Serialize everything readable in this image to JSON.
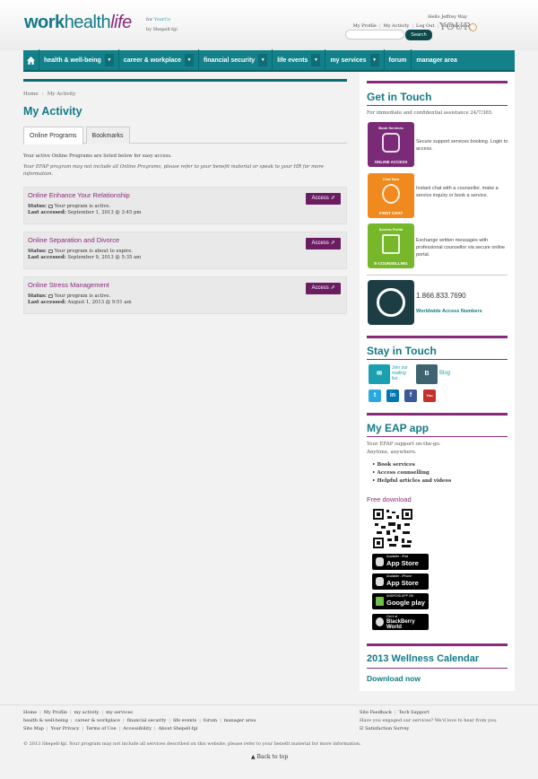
{
  "header": {
    "logo_work": "work",
    "logo_health": "health",
    "logo_life": "life",
    "for_label": "for",
    "company": "YourCo",
    "by_label": "by Shepell·fgi",
    "greeting": "Hello Jeffrey Way",
    "links": [
      "My Profile",
      "My Activity",
      "Log Out",
      "En français"
    ],
    "search_placeholder": "",
    "search_button": "Search",
    "your_logo": "YOUR"
  },
  "nav": {
    "items": [
      {
        "label": "health & well-being",
        "dropdown": true
      },
      {
        "label": "career & workplace",
        "dropdown": true
      },
      {
        "label": "financial security",
        "dropdown": true
      },
      {
        "label": "life events",
        "dropdown": true
      },
      {
        "label": "my services",
        "dropdown": true
      },
      {
        "label": "forum",
        "dropdown": false
      },
      {
        "label": "manager area",
        "dropdown": false
      }
    ]
  },
  "breadcrumb": {
    "home": "Home",
    "current": "My Activity"
  },
  "page_title": "My Activity",
  "tabs": [
    "Online Programs",
    "Bookmarks"
  ],
  "intro": "Your active Online Programs are listed below for easy access.",
  "note": "Your EFAP program may not include all Online Programs, please refer to your benefit material or speak to your HR for more information.",
  "status_label": "Status:",
  "last_accessed_label": "Last accessed:",
  "access_label": "Access",
  "programs": [
    {
      "name": "Online Enhance Your Relationship",
      "status": "Your program is active.",
      "last": "September 1, 2013 @ 3:45 pm"
    },
    {
      "name": "Online Separation and Divorce",
      "status": "Your program is about to expire.",
      "last": "September 9, 2013 @ 5:35 am"
    },
    {
      "name": "Online Stress Management",
      "status": "Your program is active.",
      "last": "August 1, 2013 @ 9:51 am"
    }
  ],
  "sidebar": {
    "get_in_touch": "Get in Touch",
    "git_sub": "For immediate and confidential assistance 24/7/365.",
    "services": [
      {
        "top": "Book Services",
        "label": "ONLINE ACCESS",
        "text": "Secure support services booking. Login to access.",
        "color": "#7b2a78"
      },
      {
        "top": "Chat Now",
        "label": "FIRST CHAT",
        "text": "Instant chat with a counsellor, make a service inquiry or book a service.",
        "color": "#f08a1e"
      },
      {
        "top": "Access Portal",
        "label": "E-COUNSELLING",
        "text": "Exchange written messages with professional counsellor via secure online portal.",
        "color": "#76b82a"
      }
    ],
    "phone": "1.866.833.7690",
    "worldwide": "Worldwide Access Numbers",
    "stay_in_touch": "Stay in Touch",
    "mailing": "Join our mailing list",
    "blog": "Blog",
    "eap_title": "My EAP app",
    "eap_sub1": "Your EFAP support on-the-go.",
    "eap_sub2": "Anytime, anywhere.",
    "eap_bullets": [
      "Book services",
      "Access counselling",
      "Helpful articles and videos"
    ],
    "free_download": "Free download",
    "badges": [
      {
        "small": "Available - iPad",
        "big": "App Store"
      },
      {
        "small": "Available - iPhone",
        "big": "App Store"
      },
      {
        "small": "ANDROID APP ON",
        "big": "Google play"
      },
      {
        "small": "Get it at",
        "big": "BlackBerry World"
      }
    ],
    "calendar_title": "2013 Wellness Calendar",
    "download_now": "Download now"
  },
  "footer": {
    "row1": [
      "Home",
      "My Profile",
      "my activity",
      "my services"
    ],
    "row2": [
      "health & well-being",
      "career & workplace",
      "financial security",
      "life events",
      "forum",
      "manager area"
    ],
    "row3": [
      "Site Map",
      "Your Privacy",
      "Terms of Use",
      "Accessibility",
      "About Shepell·fgi"
    ],
    "copyright": "© 2013 Shepell·fgi. Your program may not include all services described on this website, please refer to your benefit material for more information.",
    "right_links": [
      "Site Feedback",
      "Tech Support"
    ],
    "right_text": "Have you engaged our services? We'd love to hear from you.",
    "survey": "Satisfaction Survey",
    "back_to_top": "Back to top"
  }
}
